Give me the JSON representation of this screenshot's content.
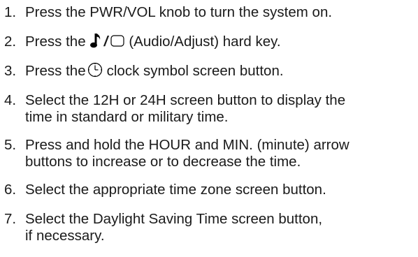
{
  "steps": [
    {
      "num": "1.",
      "lines": [
        "Press the PWR/VOL knob to turn the system on."
      ]
    },
    {
      "num": "2.",
      "before": "Press the",
      "slash": "/",
      "after": "(Audio/Adjust) hard key.",
      "icons": [
        "music-note-icon",
        "screen-button-icon"
      ]
    },
    {
      "num": "3.",
      "before": "Press the",
      "after": "clock symbol screen button.",
      "icons": [
        "clock-icon"
      ]
    },
    {
      "num": "4.",
      "lines": [
        "Select the 12H or 24H screen button to display the",
        "time in standard or military time."
      ]
    },
    {
      "num": "5.",
      "lines": [
        "Press and hold the HOUR and MIN. (minute) arrow",
        "buttons to increase or to decrease the time."
      ]
    },
    {
      "num": "6.",
      "lines": [
        "Select the appropriate time zone screen button."
      ]
    },
    {
      "num": "7.",
      "lines": [
        "Select the Daylight Saving Time screen button,",
        "if necessary."
      ]
    }
  ]
}
